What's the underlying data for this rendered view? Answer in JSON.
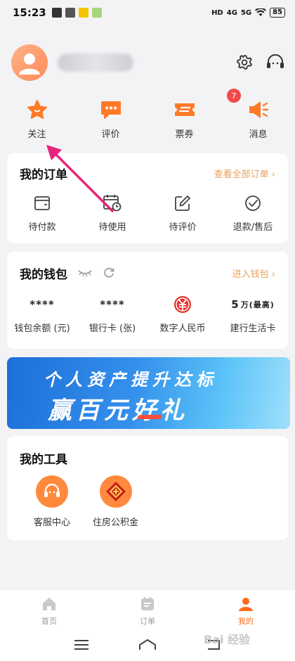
{
  "status_bar": {
    "time": "15:23",
    "network_labels": [
      "HD",
      "4G",
      "5G"
    ],
    "battery": "85"
  },
  "profile": {
    "username": "",
    "settings_icon": "gear-icon",
    "service_icon": "headset-icon"
  },
  "quick_actions": [
    {
      "label": "关注",
      "icon": "star-icon",
      "badge": null
    },
    {
      "label": "评价",
      "icon": "comment-icon",
      "badge": null
    },
    {
      "label": "票券",
      "icon": "ticket-icon",
      "badge": "7"
    },
    {
      "label": "消息",
      "icon": "speaker-icon",
      "badge": null
    }
  ],
  "orders": {
    "title": "我的订单",
    "link": "查看全部订单 ›",
    "items": [
      {
        "label": "待付款",
        "icon": "wallet-card-icon"
      },
      {
        "label": "待使用",
        "icon": "calendar-clock-icon"
      },
      {
        "label": "待评价",
        "icon": "edit-icon"
      },
      {
        "label": "退款/售后",
        "icon": "check-circle-icon"
      }
    ]
  },
  "wallet": {
    "title": "我的钱包",
    "link": "进入钱包 ›",
    "items": [
      {
        "value": "****",
        "label": "钱包余额 (元)"
      },
      {
        "value": "****",
        "label": "银行卡 (张)"
      },
      {
        "value": "",
        "label": "数字人民币",
        "icon": "digital-rmb-icon"
      },
      {
        "value": "5",
        "value_suffix": "万(最高)",
        "label": "建行生活卡"
      }
    ]
  },
  "banner": {
    "line1": "个人资产提升达标",
    "line2": "赢百元好礼"
  },
  "tools": {
    "title": "我的工具",
    "items": [
      {
        "label": "客服中心",
        "icon": "customer-service-icon"
      },
      {
        "label": "住房公积金",
        "icon": "housing-fund-icon"
      }
    ]
  },
  "tabbar": [
    {
      "label": "首页",
      "icon": "home-icon",
      "active": false
    },
    {
      "label": "订单",
      "icon": "order-icon",
      "active": false
    },
    {
      "label": "我的",
      "icon": "user-icon",
      "active": true
    }
  ],
  "watermark": "Bai 经验",
  "colors": {
    "accent": "#ff6a1a",
    "link": "#e8a05a",
    "badge": "#f34b4b",
    "pointer": "#e8247c"
  }
}
